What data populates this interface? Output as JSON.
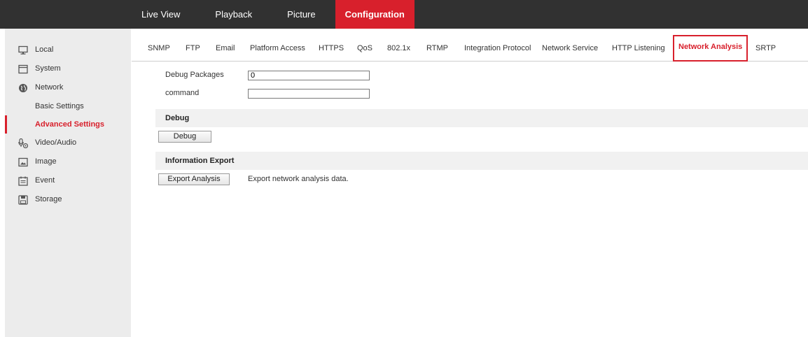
{
  "topnav": {
    "items": [
      {
        "label": "Live View",
        "active": false
      },
      {
        "label": "Playback",
        "active": false
      },
      {
        "label": "Picture",
        "active": false
      },
      {
        "label": "Configuration",
        "active": true
      }
    ]
  },
  "sidebar": {
    "local": "Local",
    "system": "System",
    "network": "Network",
    "basic_settings": "Basic Settings",
    "advanced_settings": "Advanced Settings",
    "video_audio": "Video/Audio",
    "image": "Image",
    "event": "Event",
    "storage": "Storage"
  },
  "tabs": {
    "snmp": "SNMP",
    "ftp": "FTP",
    "email": "Email",
    "platform_access": "Platform Access",
    "https": "HTTPS",
    "qos": "QoS",
    "dot1x": "802.1x",
    "rtmp": "RTMP",
    "integration_protocol": "Integration Protocol",
    "network_service": "Network Service",
    "http_listening": "HTTP Listening",
    "network_analysis": "Network Analysis",
    "srtp": "SRTP",
    "active": "Network Analysis"
  },
  "form": {
    "debug_packages_label": "Debug Packages",
    "debug_packages_value": "0",
    "command_label": "command",
    "command_value": ""
  },
  "debug_section": {
    "title": "Debug",
    "button": "Debug"
  },
  "export_section": {
    "title": "Information Export",
    "button": "Export Analysis",
    "note": "Export network analysis data."
  },
  "colors": {
    "accent": "#d8202c",
    "topbar": "#313131",
    "sidebar": "#ececec"
  }
}
